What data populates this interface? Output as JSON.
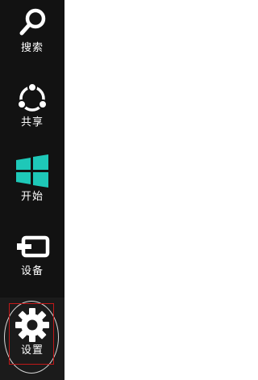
{
  "charms": {
    "search": {
      "label": "搜索",
      "icon": "search-icon"
    },
    "share": {
      "label": "共享",
      "icon": "share-icon"
    },
    "start": {
      "label": "开始",
      "icon": "windows-start-icon"
    },
    "devices": {
      "label": "设备",
      "icon": "devices-icon"
    },
    "settings": {
      "label": "设置",
      "icon": "gear-icon"
    }
  },
  "colors": {
    "bar_background": "#121212",
    "start_logo": "#1ec8b8",
    "label_text": "#ffffff",
    "highlight_box": "#c01818",
    "highlight_circle": "#d8d8d8"
  }
}
